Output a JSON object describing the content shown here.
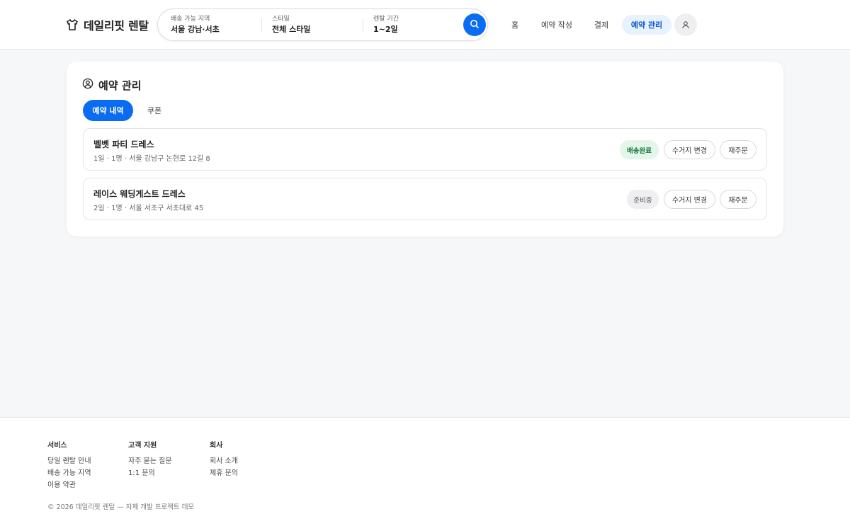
{
  "header": {
    "logo_text": "데일리핏 렌탈",
    "search": {
      "region_label": "배송 가능 지역",
      "region_value": "서울 강남·서초",
      "style_label": "스타일",
      "style_value": "전체 스타일",
      "period_label": "렌탈 기간",
      "period_value": "1~2일"
    },
    "nav": {
      "home": "홈",
      "write": "예약 작성",
      "payment": "결제",
      "manage": "예약 관리"
    }
  },
  "main": {
    "title": "예약 관리",
    "tabs": [
      {
        "label": "예약 내역",
        "active": true
      },
      {
        "label": "쿠폰",
        "active": false
      }
    ],
    "reservations": [
      {
        "name": "벨벳 파티 드레스",
        "meta": "1일 · 1명 · 서울 강남구 논현로 12길 8",
        "status": "배송완료",
        "change_label": "수거지 변경",
        "reorder_label": "재주문"
      },
      {
        "name": "레이스 웨딩게스트 드레스",
        "meta": "2일 · 1명 · 서울 서초구 서초대로 45",
        "status": "준비중",
        "change_label": "수거지 변경",
        "reorder_label": "재주문"
      }
    ]
  },
  "footer": {
    "columns": [
      {
        "heading": "서비스",
        "links": [
          "당일 렌탈 안내",
          "배송 가능 지역",
          "이용 약관"
        ]
      },
      {
        "heading": "고객 지원",
        "links": [
          "자주 묻는 질문",
          "1:1 문의"
        ]
      },
      {
        "heading": "회사",
        "links": [
          "회사 소개",
          "제휴 문의"
        ]
      }
    ],
    "copyright": "© 2026 데일리핏 렌탈 — 자체 개발 프로젝트 데모"
  },
  "colors": {
    "accent": "#0a6cf2",
    "active_nav_bg": "#e8f1fe",
    "status_done_bg": "#e4f6ea",
    "status_done_text": "#1a7a3f",
    "status_ready_bg": "#efeff1"
  },
  "icons": {
    "logo": "shirt-icon",
    "search": "search-icon",
    "user": "user-icon",
    "title": "user-circle-icon"
  }
}
